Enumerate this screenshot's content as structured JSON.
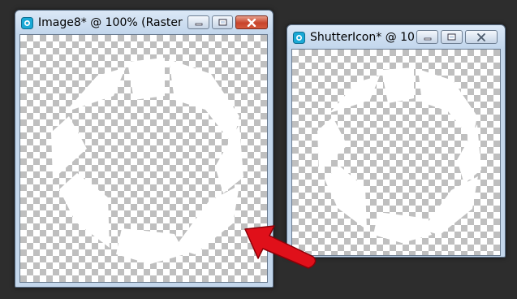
{
  "windows": [
    {
      "title": "Image8* @ 100% (Raster ...",
      "controls": [
        "minimize-icon",
        "maximize-icon",
        "close-icon"
      ]
    },
    {
      "title": "ShutterIcon* @ 10...",
      "controls": [
        "minimize-icon",
        "maximize-icon",
        "close-icon"
      ]
    }
  ],
  "colors": {
    "desktop": "#2d2d2d",
    "frame": "#c4d7ec",
    "checker_dark": "#bfbfbf",
    "checker_light": "#ffffff",
    "artwork": "#ffffff",
    "arrow": "#e0101a"
  },
  "icons": [
    "app-icon",
    "minimize-icon",
    "maximize-icon",
    "close-icon",
    "red-arrow-icon"
  ]
}
